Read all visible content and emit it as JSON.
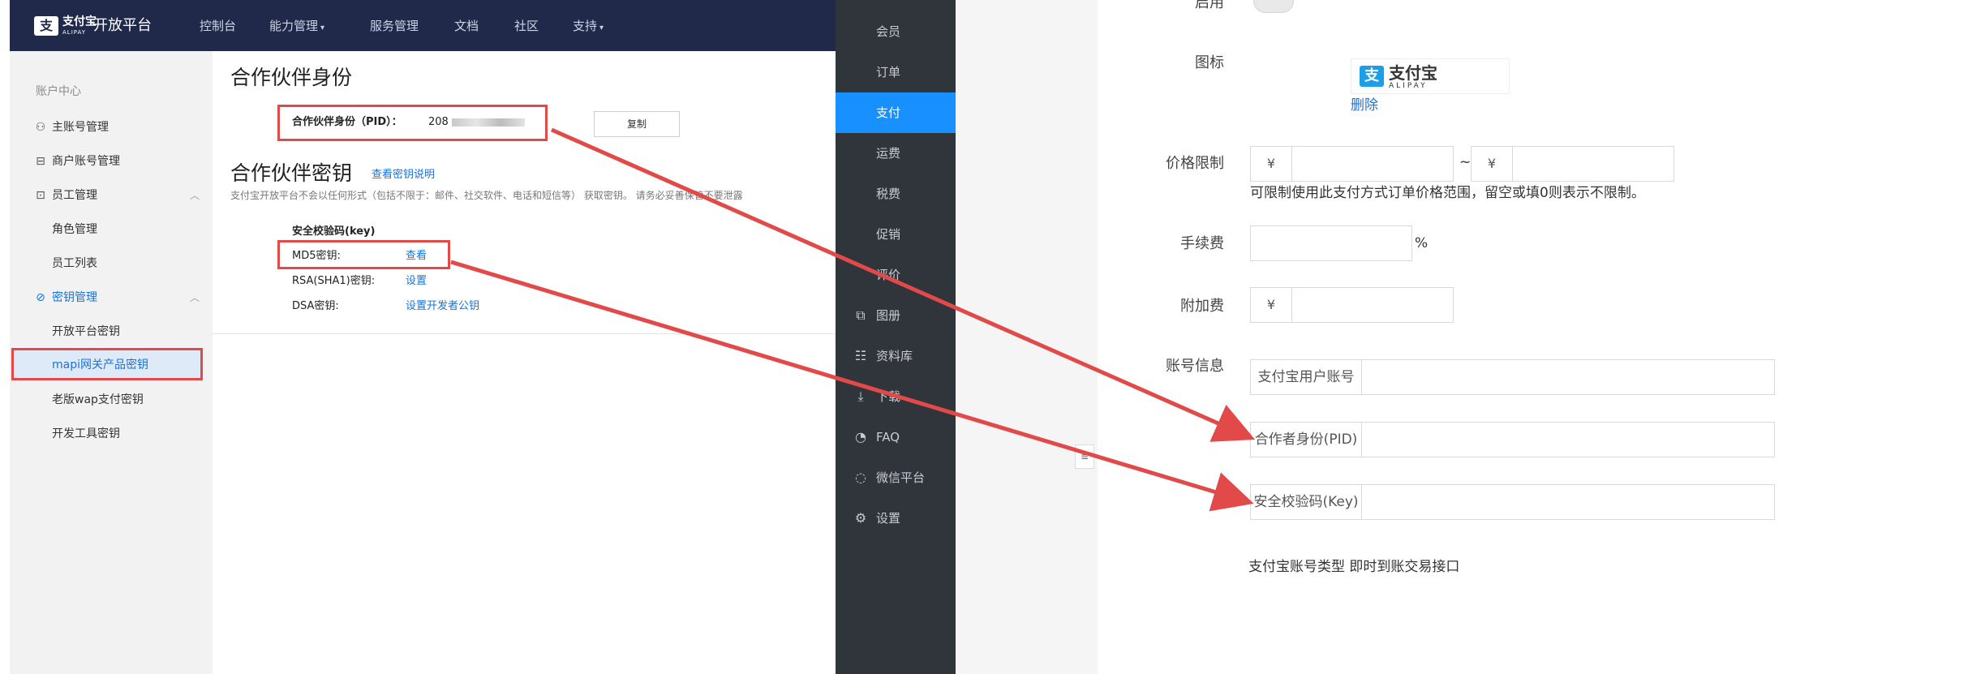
{
  "colors": {
    "annotation_red": "#e24a4a",
    "accent_blue": "#1890ff",
    "link_blue": "#1a73d9",
    "topbar_navy": "#20294a",
    "dark_menu": "#30343b"
  },
  "topbar": {
    "logo_mark": "支",
    "logo_cn": "支付宝",
    "logo_en": "ALIPAY",
    "site_name": "开放平台",
    "nav": [
      "控制台",
      "能力管理",
      "服务管理",
      "文档",
      "社区",
      "支持"
    ]
  },
  "sidebar": {
    "header": "账户中心",
    "items": [
      {
        "label": "主账号管理",
        "icon": "user-icon"
      },
      {
        "label": "商户账号管理",
        "icon": "store-icon"
      },
      {
        "label": "员工管理",
        "icon": "staff-icon"
      },
      {
        "label": "角色管理"
      },
      {
        "label": "员工列表"
      },
      {
        "label": "密钥管理",
        "icon": "key-icon"
      },
      {
        "label": "开放平台密钥"
      },
      {
        "label": "mapi网关产品密钥"
      },
      {
        "label": "老版wap支付密钥"
      },
      {
        "label": "开发工具密钥"
      }
    ]
  },
  "content": {
    "title_pid": "合作伙伴身份",
    "pid_label": "合作伙伴身份（PID）：",
    "pid_value": "208",
    "copy_button": "复制",
    "title_key": "合作伙伴密钥",
    "view_key_doc": "查看密钥说明",
    "notice": "支付宝开放平台不会以任何形式（包括不限于：邮件、社交软件、电话和短信等） 获取密钥。 请务必妥善保管不要泄露",
    "key_section": "安全校验码(key)",
    "md5_label": "MD5密钥:",
    "md5_action": "查看",
    "rsa_label": "RSA(SHA1)密钥:",
    "rsa_action": "设置",
    "dsa_label": "DSA密钥:",
    "dsa_action": "设置开发者公钥"
  },
  "darkmenu": {
    "items": [
      {
        "label": "会员"
      },
      {
        "label": "订单"
      },
      {
        "label": "支付",
        "active": true
      },
      {
        "label": "运费"
      },
      {
        "label": "税费"
      },
      {
        "label": "促销"
      },
      {
        "label": "评价"
      },
      {
        "label": "图册",
        "icon": "gallery-icon"
      },
      {
        "label": "资料库",
        "icon": "database-icon"
      },
      {
        "label": "下载",
        "icon": "download-icon"
      },
      {
        "label": "FAQ",
        "icon": "faq-icon"
      },
      {
        "label": "微信平台",
        "icon": "wechat-icon"
      },
      {
        "label": "设置",
        "icon": "gear-icon"
      }
    ]
  },
  "form": {
    "enable_label": "启用",
    "icon_label": "图标",
    "logo_cn": "支付宝",
    "logo_en": "ALIPAY",
    "delete_link": "删除",
    "price_label": "价格限制",
    "currency": "¥",
    "range_sep": "~",
    "price_help": "可限制使用此支付方式订单价格范围，留空或填0则表示不限制。",
    "fee_label": "手续费",
    "percent": "%",
    "surcharge_label": "附加费",
    "account_label": "账号信息",
    "alipay_account_addon": "支付宝用户账号",
    "partner_pid_addon": "合作者身份(PID)",
    "security_key_addon": "安全校验码(Key)",
    "account_type_label": "支付宝账号类型",
    "account_type_value": "即时到账交易接口"
  }
}
